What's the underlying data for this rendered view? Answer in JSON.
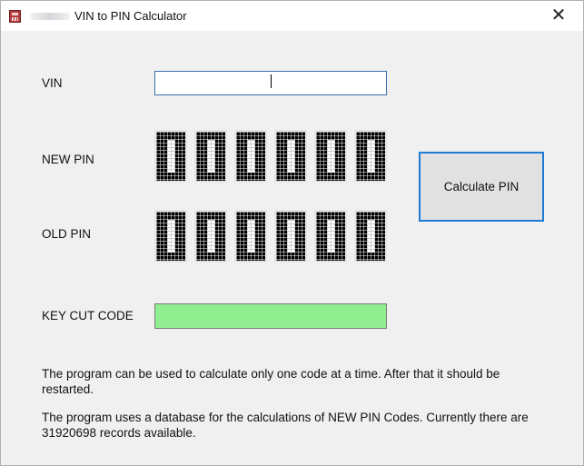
{
  "window": {
    "title": "VIN to PIN Calculator",
    "close_glyph": "✕",
    "app_icon": "calculator-icon"
  },
  "form": {
    "vin_label": "VIN",
    "vin_value": "",
    "new_pin_label": "NEW PIN",
    "new_pin_digits": [
      "0",
      "0",
      "0",
      "0",
      "0",
      "0"
    ],
    "old_pin_label": "OLD PIN",
    "old_pin_digits": [
      "0",
      "0",
      "0",
      "0",
      "0",
      "0"
    ],
    "key_cut_label": "KEY CUT CODE",
    "key_cut_value": "",
    "calculate_label": "Calculate PIN"
  },
  "info": {
    "paragraph_1": "The program can be used to calculate only one code at a time. After that it should be restarted.",
    "paragraph_2": "The program uses a database for the calculations of NEW PIN Codes. Currently there are 31920698 records available."
  },
  "colors": {
    "key_cut_fill": "#90ee90",
    "button_border": "#1f7ad6",
    "window_bg": "#f0f0f0"
  }
}
